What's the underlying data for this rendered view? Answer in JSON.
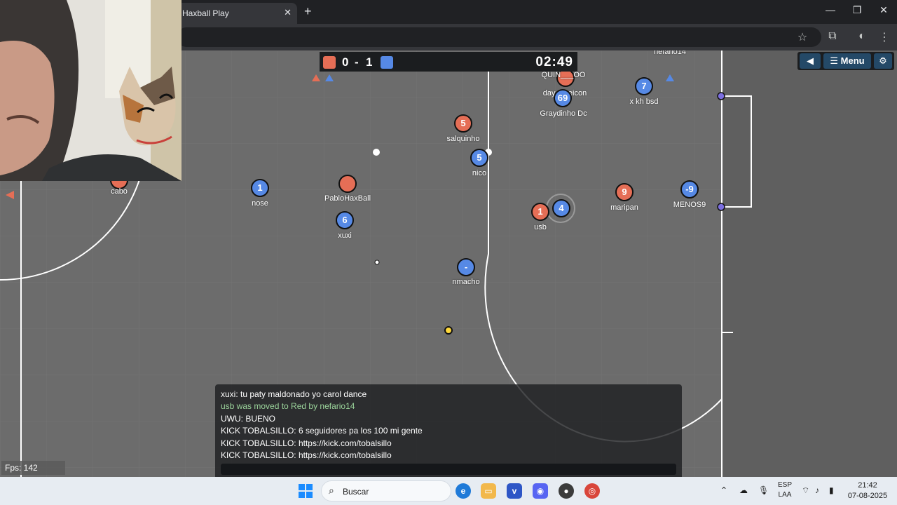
{
  "browser": {
    "tab_title": "Haxball Play",
    "tab_close": "✕",
    "new_tab": "+",
    "window_controls": [
      "—",
      "❐",
      "✕"
    ]
  },
  "hud": {
    "score_red": "0",
    "score_separator": "-",
    "score_blue": "1",
    "timer": "02:49",
    "team_colors": {
      "red": "#e56e56",
      "blue": "#5689e5"
    },
    "menu_label": "☰ Menu",
    "back_icon": "◀",
    "settings_icon": "⚙"
  },
  "players": [
    {
      "team": "red",
      "number": "",
      "name": "cabo"
    },
    {
      "team": "blue",
      "number": "1",
      "name": "nose"
    },
    {
      "team": "red",
      "number": "",
      "name": "PabloHaxBall"
    },
    {
      "team": "blue",
      "number": "6",
      "name": "xuxi"
    },
    {
      "team": "red",
      "number": "5",
      "name": "salquinho"
    },
    {
      "team": "blue",
      "number": "5",
      "name": "nico"
    },
    {
      "team": "blue",
      "number": "-",
      "name": "nmacho"
    },
    {
      "team": "red",
      "number": "",
      "name": "QUIN___OO"
    },
    {
      "team": "blue",
      "number": "69",
      "name": "Graydinho Dc"
    },
    {
      "team": "blue",
      "number": "",
      "name": "day___eicon"
    },
    {
      "team": "blue",
      "number": "7",
      "name": "x kh bsd"
    },
    {
      "team": "red",
      "number": "1",
      "name": "usb"
    },
    {
      "team": "blue",
      "number": "4",
      "name": ""
    },
    {
      "team": "red",
      "number": "9",
      "name": "maripan"
    },
    {
      "team": "blue",
      "number": "-9",
      "name": "MENOS9"
    },
    {
      "team": "blue",
      "number": "",
      "name": "nefario14"
    }
  ],
  "chat": {
    "messages": [
      {
        "text": "xuxi: tu paty maldonado yo carol dance",
        "type": "chat"
      },
      {
        "text": "usb was moved to Red by nefario14",
        "type": "announce"
      },
      {
        "text": "UWU: BUENO",
        "type": "chat"
      },
      {
        "text": "KICK TOBALSILLO: 6 seguidores pa los 100 mi gente",
        "type": "chat"
      },
      {
        "text": "KICK TOBALSILLO: https://kick.com/tobalsillo",
        "type": "chat"
      },
      {
        "text": "KICK TOBALSILLO: https://kick.com/tobalsillo",
        "type": "chat"
      }
    ],
    "input_value": ""
  },
  "fps": "Fps: 142",
  "taskbar": {
    "search_label": "Buscar",
    "language": "ESP",
    "layout": "LAA",
    "time": "21:42",
    "date": "07-08-2025"
  }
}
